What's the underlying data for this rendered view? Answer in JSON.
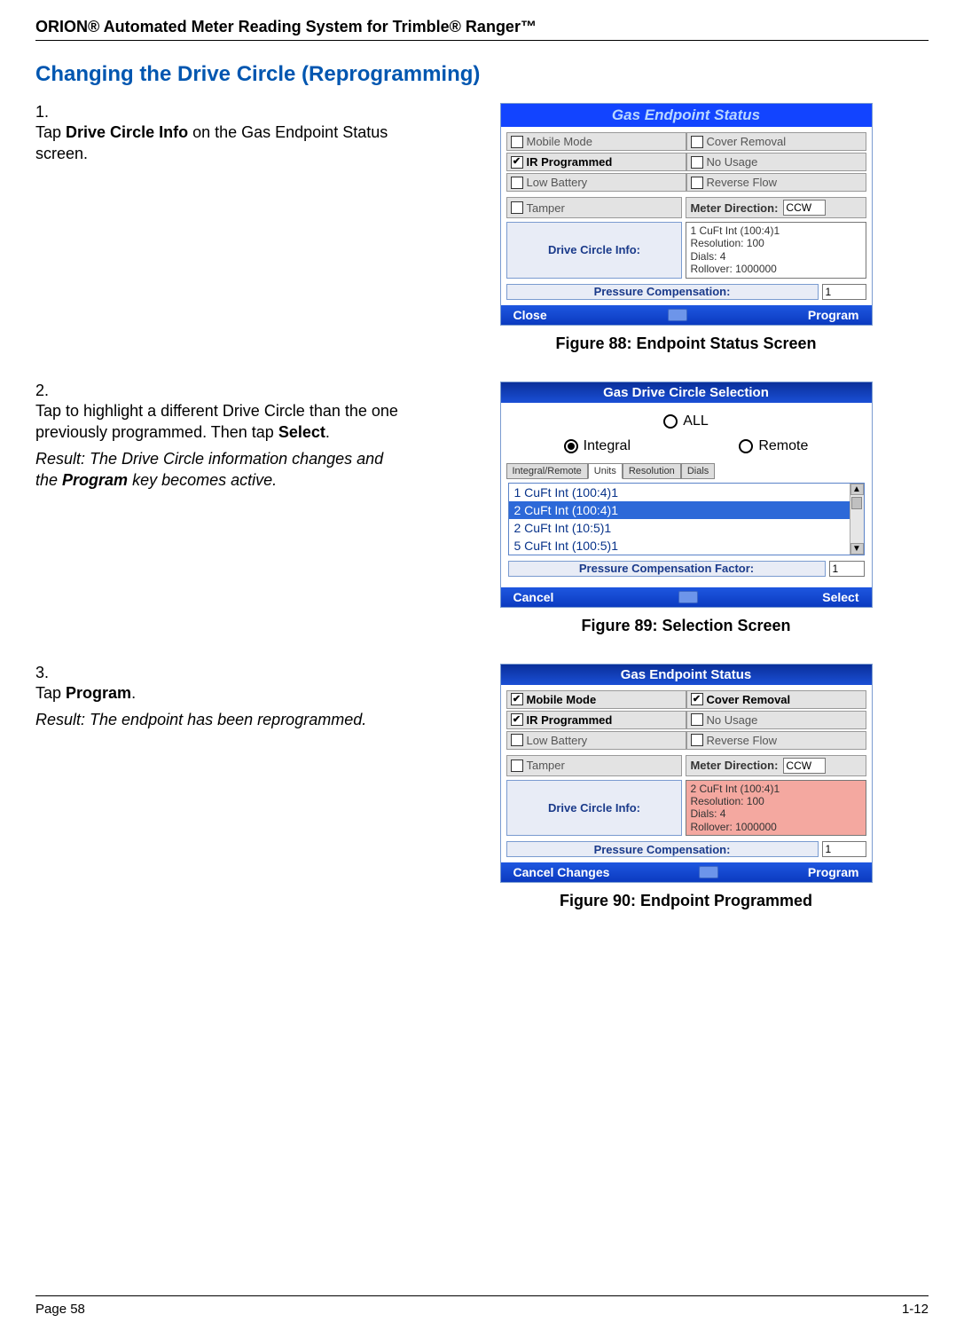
{
  "doc": {
    "header": "ORION® Automated Meter Reading System for Trimble® Ranger™",
    "section_title": "Changing the Drive Circle (Reprogramming)",
    "footer_left": "Page 58",
    "footer_right": "1-12"
  },
  "steps": {
    "s1": {
      "num": "1.",
      "pre": "Tap ",
      "bold": "Drive Circle Info",
      "post": " on the Gas Endpoint Status screen."
    },
    "s2": {
      "num": "2.",
      "line1a": "Tap to highlight a different Drive Circle than the one previously programmed. Then tap ",
      "line1b": "Select",
      "line1c": ".",
      "result_a": "Result: The Drive Circle information changes and the ",
      "result_b": "Program",
      "result_c": " key becomes active."
    },
    "s3": {
      "num": "3.",
      "pre": "Tap ",
      "bold": "Program",
      "post": ".",
      "result": "Result: The endpoint has been reprogrammed."
    }
  },
  "captions": {
    "f88": "Figure 88:  Endpoint Status Screen",
    "f89": "Figure 89:  Selection Screen",
    "f90": "Figure 90:  Endpoint Programmed"
  },
  "fig88": {
    "title": "Gas Endpoint Status",
    "checks": {
      "mobile": {
        "label": "Mobile Mode",
        "checked": false
      },
      "cover": {
        "label": "Cover Removal",
        "checked": false
      },
      "ir": {
        "label": "IR Programmed",
        "checked": true
      },
      "nou": {
        "label": "No Usage",
        "checked": false
      },
      "lowb": {
        "label": "Low Battery",
        "checked": false
      },
      "rev": {
        "label": "Reverse Flow",
        "checked": false
      },
      "tamper": {
        "label": "Tamper",
        "checked": false
      }
    },
    "meter_dir_label": "Meter Direction:",
    "meter_dir_value": "CCW",
    "dci_label": "Drive Circle Info:",
    "dci_lines": {
      "l1": "1 CuFt Int (100:4)1",
      "l2": "Resolution: 100",
      "l3": "Dials: 4",
      "l4": "Rollover: 1000000"
    },
    "pc_label": "Pressure Compensation:",
    "pc_value": "1",
    "btn_left": "Close",
    "btn_right": "Program"
  },
  "fig89": {
    "title": "Gas Drive Circle Selection",
    "radios": {
      "all": "ALL",
      "integral": "Integral",
      "remote": "Remote"
    },
    "tabs": {
      "t0": "Integral/Remote",
      "t1": "Units",
      "t2": "Resolution",
      "t3": "Dials"
    },
    "list": {
      "r0": "1 CuFt Int (100:4)1",
      "r1": "2 CuFt Int (100:4)1",
      "r2": "2 CuFt Int (10:5)1",
      "r3": "5 CuFt Int (100:5)1"
    },
    "pcf_label": "Pressure Compensation Factor:",
    "pcf_value": "1",
    "btn_left": "Cancel",
    "btn_right": "Select"
  },
  "fig90": {
    "title": "Gas Endpoint Status",
    "checks": {
      "mobile": {
        "label": "Mobile Mode",
        "checked": true
      },
      "cover": {
        "label": "Cover Removal",
        "checked": true
      },
      "ir": {
        "label": "IR Programmed",
        "checked": true
      },
      "nou": {
        "label": "No Usage",
        "checked": false
      },
      "lowb": {
        "label": "Low Battery",
        "checked": false
      },
      "rev": {
        "label": "Reverse Flow",
        "checked": false
      },
      "tamper": {
        "label": "Tamper",
        "checked": false
      }
    },
    "meter_dir_label": "Meter Direction:",
    "meter_dir_value": "CCW",
    "dci_label": "Drive Circle Info:",
    "dci_lines": {
      "l1": "2 CuFt Int (100:4)1",
      "l2": "Resolution: 100",
      "l3": "Dials: 4",
      "l4": "Rollover: 1000000"
    },
    "pc_label": "Pressure Compensation:",
    "pc_value": "1",
    "btn_left": "Cancel Changes",
    "btn_right": "Program"
  }
}
